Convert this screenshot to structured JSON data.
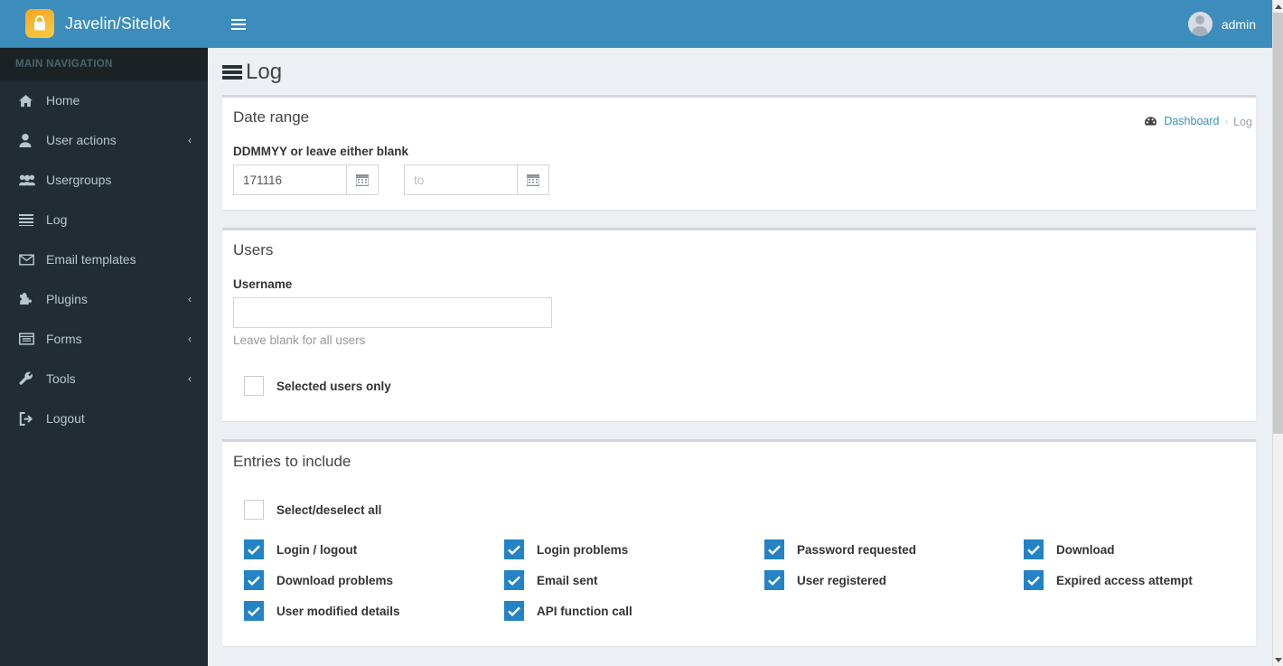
{
  "brand": {
    "name": "Javelin/Sitelok",
    "logo_icon": "padlock-icon",
    "accent_blue": "#3c8dbc",
    "sidebar_dark": "#222d32",
    "logo_orange": "#f7b733"
  },
  "navbar": {
    "toggle_icon": "hamburger-icon",
    "user_name": "admin",
    "avatar_icon": "user-avatar-icon"
  },
  "sidebar": {
    "header": "MAIN NAVIGATION",
    "items": [
      {
        "label": "Home",
        "icon": "home-icon",
        "caret": ""
      },
      {
        "label": "User actions",
        "icon": "user-icon",
        "caret": "‹"
      },
      {
        "label": "Usergroups",
        "icon": "users-icon",
        "caret": ""
      },
      {
        "label": "Log",
        "icon": "list-icon",
        "caret": ""
      },
      {
        "label": "Email templates",
        "icon": "envelope-icon",
        "caret": ""
      },
      {
        "label": "Plugins",
        "icon": "puzzle-icon",
        "caret": "‹"
      },
      {
        "label": "Forms",
        "icon": "window-icon",
        "caret": "‹"
      },
      {
        "label": "Tools",
        "icon": "wrench-icon",
        "caret": "‹"
      },
      {
        "label": "Logout",
        "icon": "sign-out-icon",
        "caret": ""
      }
    ]
  },
  "content_header": {
    "title": "Log",
    "title_icon": "list-icon",
    "breadcrumb": {
      "home_icon": "dashboard-icon",
      "home_label": "Dashboard",
      "separator": "›",
      "current_label": "Log"
    }
  },
  "date_range": {
    "title": "Date range",
    "label": "DDMMYY or leave either blank",
    "from_value": "171116",
    "from_placeholder": "",
    "to_value": "",
    "to_placeholder": "to",
    "calendar_icon": "calendar-icon"
  },
  "users": {
    "title": "Users",
    "label": "Username",
    "value": "",
    "placeholder": "",
    "help": "Leave blank for all users",
    "selected_only": {
      "label": "Selected users only",
      "checked": false
    }
  },
  "entries": {
    "title": "Entries to include",
    "select_all": {
      "label": "Select/deselect all",
      "checked": false
    },
    "options": [
      {
        "label": "Login / logout",
        "checked": true
      },
      {
        "label": "Login problems",
        "checked": true
      },
      {
        "label": "Password requested",
        "checked": true
      },
      {
        "label": "Download",
        "checked": true
      },
      {
        "label": "Download problems",
        "checked": true
      },
      {
        "label": "Email sent",
        "checked": true
      },
      {
        "label": "User registered",
        "checked": true
      },
      {
        "label": "Expired access attempt",
        "checked": true
      },
      {
        "label": "User modified details",
        "checked": true
      },
      {
        "label": "API function call",
        "checked": true
      }
    ]
  },
  "scrollbar": {
    "up_icon": "chevron-up-icon",
    "down_icon": "chevron-down-icon"
  }
}
